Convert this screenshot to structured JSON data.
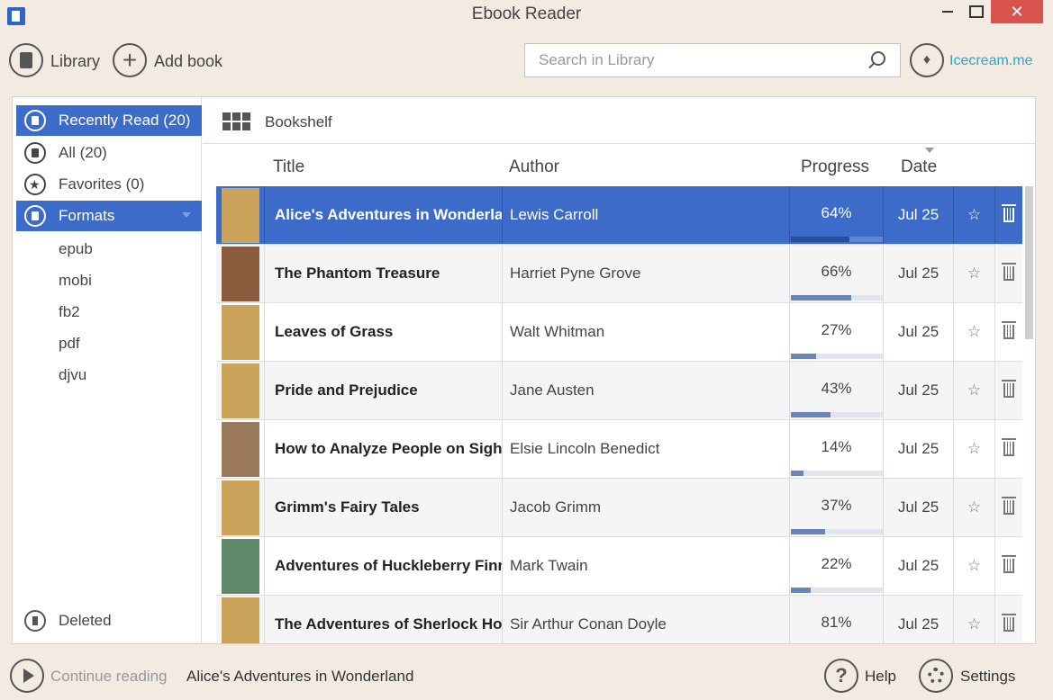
{
  "window": {
    "title": "Ebook Reader",
    "close_glyph": "✕"
  },
  "toolbar": {
    "library_label": "Library",
    "add_book_label": "Add book",
    "add_glyph": "+",
    "search_placeholder": "Search in Library",
    "brand_label": "Icecream.me",
    "brand_glyph": "♦",
    "brand_color": "#2aa7c9"
  },
  "sidebar": {
    "items": [
      {
        "label": "Recently Read (20)",
        "icon": "recent-icon",
        "active": true
      },
      {
        "label": "All (20)",
        "icon": "books-icon",
        "active": false
      },
      {
        "label": "Favorites (0)",
        "icon": "star-icon",
        "active": false
      },
      {
        "label": "Formats",
        "icon": "file-icon",
        "active": true
      }
    ],
    "formats": [
      "epub",
      "mobi",
      "fb2",
      "pdf",
      "djvu"
    ],
    "deleted_label": "Deleted"
  },
  "content": {
    "view_label": "Bookshelf",
    "columns": {
      "title": "Title",
      "author": "Author",
      "progress": "Progress",
      "date": "Date"
    }
  },
  "books": [
    {
      "title": "Alice's Adventures in Wonderland",
      "author": "Lewis Carroll",
      "progress": "64%",
      "progress_value": 0.64,
      "date": "Jul 25",
      "cover_color": "#c9a45a",
      "selected": true
    },
    {
      "title": "The Phantom Treasure",
      "author": "Harriet Pyne Grove",
      "progress": "66%",
      "progress_value": 0.66,
      "date": "Jul 25",
      "cover_color": "#8a5a3c",
      "selected": false
    },
    {
      "title": "Leaves of Grass",
      "author": "Walt Whitman",
      "progress": "27%",
      "progress_value": 0.27,
      "date": "Jul 25",
      "cover_color": "#c9a45a",
      "selected": false
    },
    {
      "title": "Pride and Prejudice",
      "author": "Jane Austen",
      "progress": "43%",
      "progress_value": 0.43,
      "date": "Jul 25",
      "cover_color": "#c9a45a",
      "selected": false
    },
    {
      "title": "How to Analyze People on Sight",
      "author": "Elsie Lincoln Benedict",
      "progress": "14%",
      "progress_value": 0.14,
      "date": "Jul 25",
      "cover_color": "#9b7a5a",
      "selected": false
    },
    {
      "title": "Grimm's Fairy Tales",
      "author": "Jacob Grimm",
      "progress": "37%",
      "progress_value": 0.37,
      "date": "Jul 25",
      "cover_color": "#c9a45a",
      "selected": false
    },
    {
      "title": "Adventures of Huckleberry Finn",
      "author": "Mark Twain",
      "progress": "22%",
      "progress_value": 0.22,
      "date": "Jul 25",
      "cover_color": "#5f8a6a",
      "selected": false
    },
    {
      "title": "The Adventures of Sherlock Holmes",
      "author": "Sir Arthur Conan Doyle",
      "progress": "81%",
      "progress_value": 0.81,
      "date": "Jul 25",
      "cover_color": "#c9a45a",
      "selected": false
    }
  ],
  "star_glyph": "☆",
  "footer": {
    "continue_label": "Continue reading",
    "continue_book": "Alice's Adventures in Wonderland",
    "help_label": "Help",
    "help_glyph": "?",
    "settings_label": "Settings"
  },
  "colors": {
    "accent": "#3d6bc9",
    "background": "#f3ebe1",
    "close": "#d9534f"
  }
}
